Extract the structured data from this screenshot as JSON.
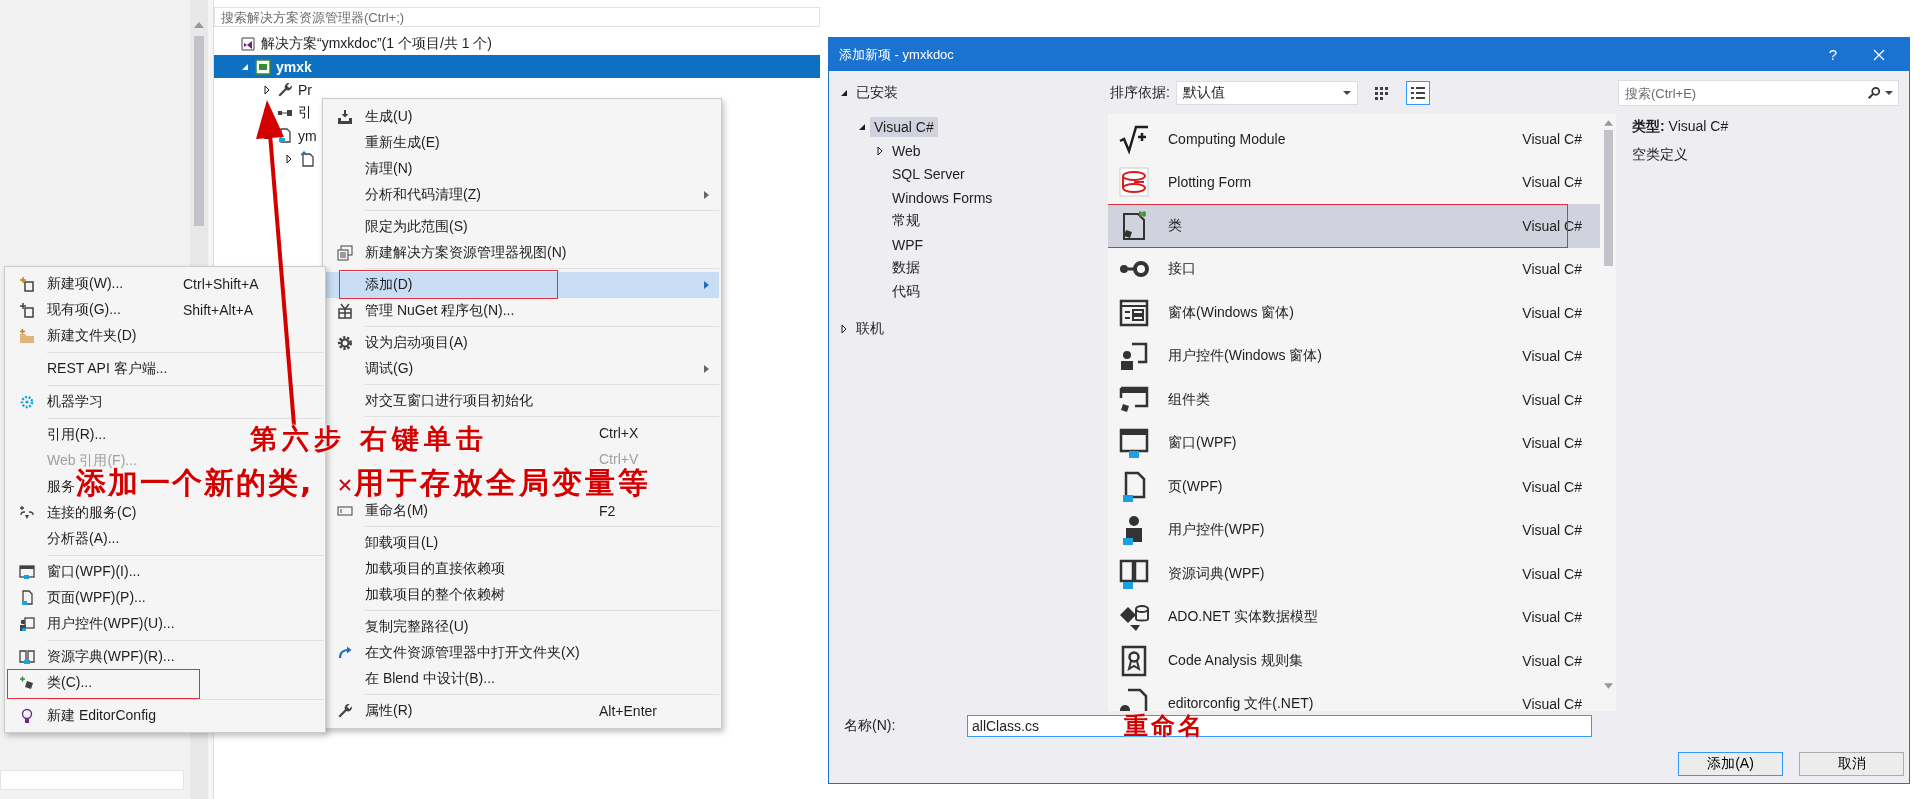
{
  "solution_explorer": {
    "search": {
      "placeholder": "搜索解决方案资源管理器(Ctrl+;)"
    },
    "tree": [
      {
        "label": "解决方案“ymxkdoc”(1 个项目/共 1 个)",
        "selected": false
      },
      {
        "label": "ymxk",
        "selected": true,
        "expanded": true,
        "children": [
          {
            "label": "Pr",
            "selected": false,
            "expanded": false
          },
          {
            "label": "引",
            "selected": false,
            "expanded": false
          },
          {
            "label": "ym",
            "selected": false,
            "expanded": true,
            "children": [
              {
                "selected": false,
                "expanded": false
              }
            ]
          }
        ]
      }
    ]
  },
  "context_menu": {
    "items": [
      {
        "kind": "item",
        "label": "生成(U)"
      },
      {
        "kind": "item",
        "label": "重新生成(E)"
      },
      {
        "kind": "item",
        "label": "清理(N)"
      },
      {
        "kind": "item",
        "label": "分析和代码清理(Z)",
        "submenu": true
      },
      {
        "kind": "separator"
      },
      {
        "kind": "item",
        "label": "限定为此范围(S)"
      },
      {
        "kind": "item",
        "label": "新建解决方案资源管理器视图(N)"
      },
      {
        "kind": "separator"
      },
      {
        "kind": "item",
        "label": "添加(D)",
        "submenu": true,
        "highlighted": true,
        "outlined": true
      },
      {
        "kind": "item",
        "label": "管理 NuGet 程序包(N)..."
      },
      {
        "kind": "separator"
      },
      {
        "kind": "item",
        "label": "设为启动项目(A)"
      },
      {
        "kind": "item",
        "label": "调试(G)",
        "submenu": true
      },
      {
        "kind": "separator"
      },
      {
        "kind": "item",
        "label": "对交互窗口进行项目初始化"
      },
      {
        "kind": "separator"
      },
      {
        "kind": "item",
        "shortcut": "Ctrl+X"
      },
      {
        "kind": "item",
        "shortcut": "Ctrl+V",
        "disabled": true
      },
      {
        "kind": "item"
      },
      {
        "kind": "item",
        "label": "重命名(M)",
        "shortcut": "F2"
      },
      {
        "kind": "separator"
      },
      {
        "kind": "item",
        "label": "卸载项目(L)"
      },
      {
        "kind": "item",
        "label": "加载项目的直接依赖项"
      },
      {
        "kind": "item",
        "label": "加载项目的整个依赖树"
      },
      {
        "kind": "separator"
      },
      {
        "kind": "item",
        "label": "复制完整路径(U)"
      },
      {
        "kind": "item",
        "label": "在文件资源管理器中打开文件夹(X)"
      },
      {
        "kind": "item",
        "label": "在 Blend 中设计(B)..."
      },
      {
        "kind": "separator"
      },
      {
        "kind": "item",
        "label": "属性(R)",
        "shortcut": "Alt+Enter"
      }
    ]
  },
  "add_submenu": {
    "items": [
      {
        "kind": "item",
        "label": "新建项(W)...",
        "shortcut": "Ctrl+Shift+A"
      },
      {
        "kind": "item",
        "label": "现有项(G)...",
        "shortcut": "Shift+Alt+A"
      },
      {
        "kind": "item",
        "label": "新建文件夹(D)"
      },
      {
        "kind": "separator"
      },
      {
        "kind": "item",
        "label": "REST API 客户端..."
      },
      {
        "kind": "separator"
      },
      {
        "kind": "item",
        "label": "机器学习"
      },
      {
        "kind": "separator"
      },
      {
        "kind": "item",
        "label": "引用(R)..."
      },
      {
        "kind": "item",
        "label": "Web 引用(F)...",
        "disabled": true
      },
      {
        "kind": "item",
        "label": "服务"
      },
      {
        "kind": "item",
        "label": "连接的服务(C)"
      },
      {
        "kind": "item",
        "label": "分析器(A)..."
      },
      {
        "kind": "separator"
      },
      {
        "kind": "item",
        "label": "窗口(WPF)(I)..."
      },
      {
        "kind": "item",
        "label": "页面(WPF)(P)..."
      },
      {
        "kind": "item",
        "label": "用户控件(WPF)(U)..."
      },
      {
        "kind": "separator"
      },
      {
        "kind": "item",
        "label": "资源字典(WPF)(R)..."
      },
      {
        "kind": "item",
        "label": "类(C)...",
        "outlined": true
      },
      {
        "kind": "separator"
      },
      {
        "kind": "item",
        "label": "新建 EditorConfig"
      }
    ]
  },
  "step_note": [
    "第六步 右键单击",
    "添加一个新的类,",
    "用于存放全局变量等"
  ],
  "dialog": {
    "title": "添加新项 - ymxkdoc",
    "help": "?",
    "categories": [
      {
        "label": "已安装",
        "expanded": true,
        "selected": false,
        "children": [
          {
            "label": "Visual C#",
            "expanded": true,
            "selected": true,
            "children": [
              {
                "label": "Web",
                "expanded": false,
                "selected": false
              },
              {
                "label": "SQL Server",
                "selected": false
              },
              {
                "label": "Windows Forms",
                "selected": false
              },
              {
                "label": "常规",
                "selected": false
              },
              {
                "label": "WPF",
                "selected": false
              },
              {
                "label": "数据",
                "selected": false
              },
              {
                "label": "代码",
                "selected": false
              }
            ]
          }
        ]
      },
      {
        "label": "联机",
        "expanded": false,
        "selected": false
      }
    ],
    "sort": {
      "label": "排序依据:",
      "value": "默认值"
    },
    "view_modes": [
      {
        "kind": "grid",
        "selected": false
      },
      {
        "kind": "list",
        "selected": true
      }
    ],
    "templates": [
      {
        "name": "Computing Module",
        "type": "Visual C#",
        "selected": false
      },
      {
        "name": "Plotting Form",
        "type": "Visual C#",
        "selected": false
      },
      {
        "name": "类",
        "type": "Visual C#",
        "selected": true,
        "outlined": true
      },
      {
        "name": "接口",
        "type": "Visual C#",
        "selected": false
      },
      {
        "name": "窗体(Windows 窗体)",
        "type": "Visual C#",
        "selected": false
      },
      {
        "name": "用户控件(Windows 窗体)",
        "type": "Visual C#",
        "selected": false
      },
      {
        "name": "组件类",
        "type": "Visual C#",
        "selected": false
      },
      {
        "name": "窗口(WPF)",
        "type": "Visual C#",
        "selected": false
      },
      {
        "name": "页(WPF)",
        "type": "Visual C#",
        "selected": false
      },
      {
        "name": "用户控件(WPF)",
        "type": "Visual C#",
        "selected": false
      },
      {
        "name": "资源词典(WPF)",
        "type": "Visual C#",
        "selected": false
      },
      {
        "name": "ADO.NET 实体数据模型",
        "type": "Visual C#",
        "selected": false
      },
      {
        "name": "Code Analysis 规则集",
        "type": "Visual C#",
        "selected": false
      },
      {
        "name": "editorconfig 文件(.NET)",
        "type": "Visual C#",
        "selected": false
      }
    ],
    "search": {
      "placeholder": "搜索(Ctrl+E)"
    },
    "details": {
      "type": "**类型:** Visual C#",
      "description": "空类定义"
    },
    "name_field": {
      "label": "名称(N):",
      "value": "allClass.cs"
    },
    "rename_note": "重命名",
    "buttons": [
      {
        "label": "添加(A)",
        "kind": "primary"
      },
      {
        "label": "取消",
        "kind": "secondary"
      }
    ]
  }
}
